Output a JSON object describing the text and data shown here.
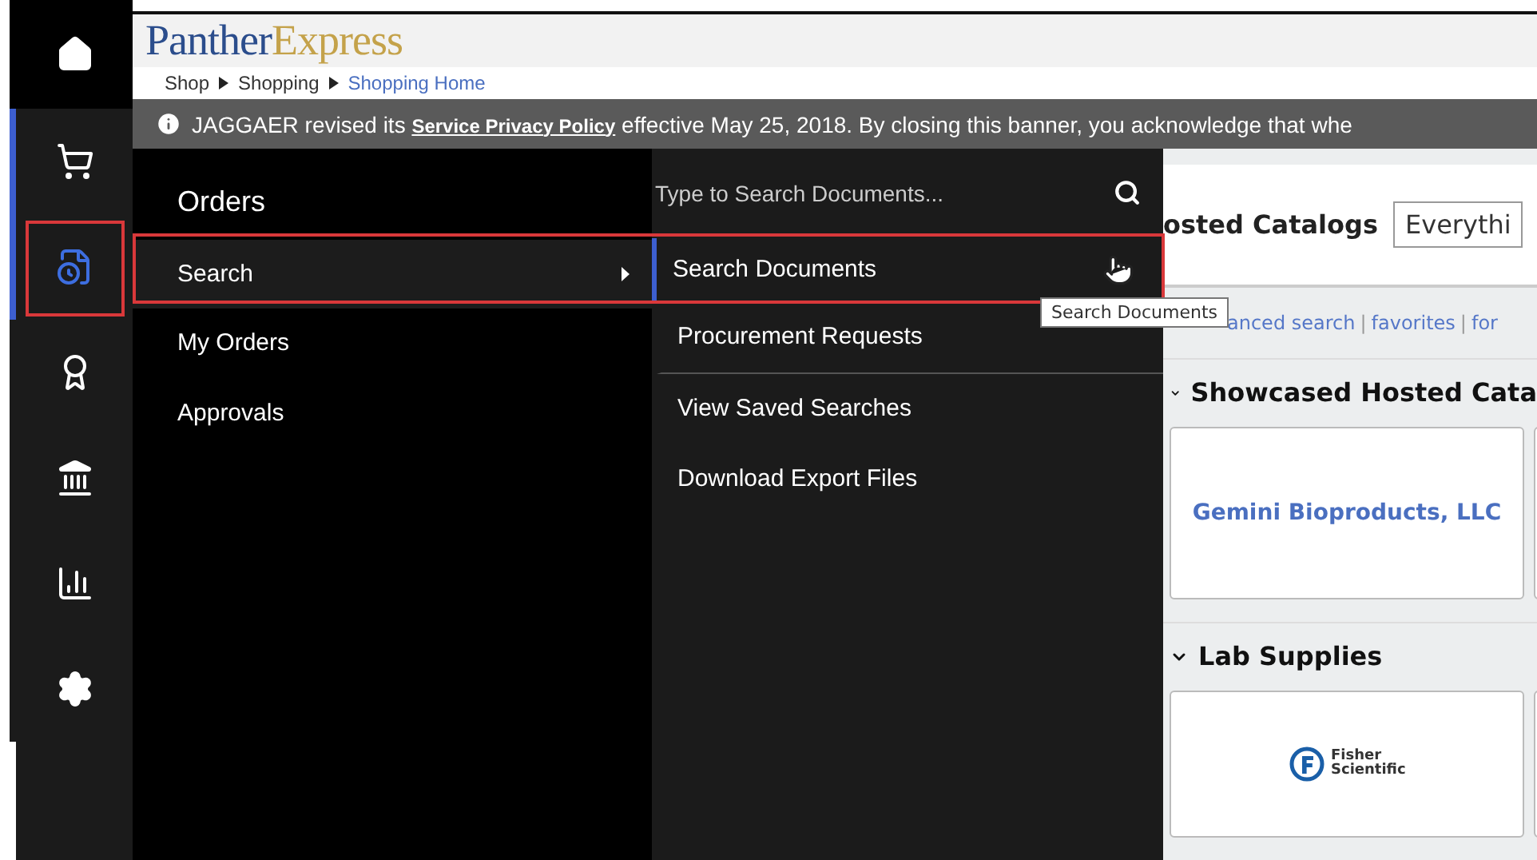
{
  "nav_rail": {
    "items": [
      {
        "selected": false
      },
      {
        "selected": false
      },
      {
        "selected": true
      },
      {
        "selected": false
      },
      {
        "selected": false
      },
      {
        "selected": false
      },
      {
        "selected": false
      }
    ]
  },
  "header": {
    "logo_first": "Panther",
    "logo_second": "Express"
  },
  "breadcrumb": [
    {
      "label": "Shop",
      "current": false
    },
    {
      "label": "Shopping",
      "current": false
    },
    {
      "label": "Shopping Home",
      "current": true
    }
  ],
  "banner": {
    "text_before": "JAGGAER revised its ",
    "link": "Service Privacy Policy",
    "text_after": " effective May 25, 2018. By closing this banner, you acknowledge that whe"
  },
  "menu": {
    "title": "Orders",
    "items": [
      {
        "label": "Search",
        "selected": true,
        "has_submenu": true
      },
      {
        "label": "My Orders",
        "selected": false,
        "has_submenu": false
      },
      {
        "label": "Approvals",
        "selected": false,
        "has_submenu": false
      }
    ]
  },
  "submenu": {
    "search": {
      "placeholder": "Type to Search Documents..."
    },
    "items": [
      {
        "label": "Search Documents",
        "selected": true,
        "divider_after": false
      },
      {
        "label": "Procurement Requests",
        "selected": false,
        "divider_after": true
      },
      {
        "label": "View Saved Searches",
        "selected": false,
        "divider_after": false
      },
      {
        "label": "Download Export Files",
        "selected": false,
        "divider_after": false
      }
    ]
  },
  "tooltip": "Search Documents",
  "content": {
    "search_label": "osted Catalogs",
    "scope_value": "Everythi",
    "links": [
      "anced search",
      "favorites",
      "for"
    ],
    "link_separator": "|",
    "sections": [
      {
        "title": "Showcased Hosted Cata",
        "cards": [
          {
            "label": "Gemini Bioproducts, LLC",
            "kind": "text"
          }
        ]
      },
      {
        "title": "Lab Supplies",
        "cards": [
          {
            "label": "Fisher Scientific",
            "kind": "logo"
          }
        ]
      }
    ]
  }
}
